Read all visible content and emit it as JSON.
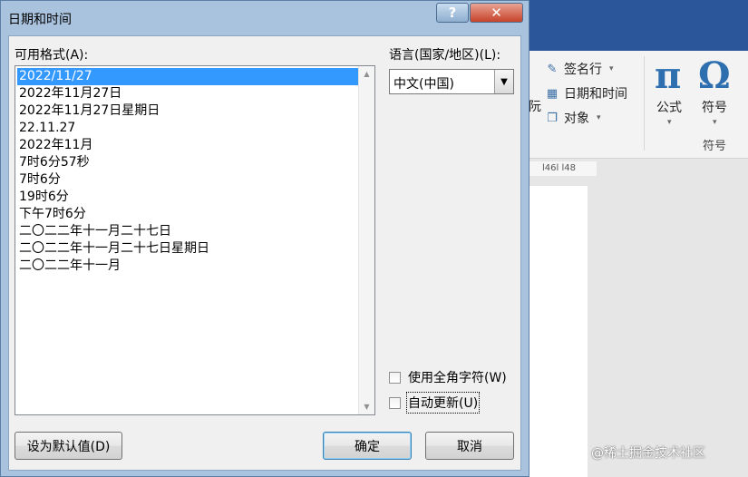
{
  "dialog": {
    "title": "日期和时间",
    "available_formats_label": "可用格式(A):",
    "formats": [
      "2022/11/27",
      "2022年11月27日",
      "2022年11月27日星期日",
      "22.11.27",
      "2022年11月",
      "7时6分57秒",
      "7时6分",
      "19时6分",
      "下午7时6分",
      "二〇二二年十一月二十七日",
      "二〇二二年十一月二十七日星期日",
      "二〇二二年十一月"
    ],
    "selected_index": 0,
    "language_label": "语言(国家/地区)(L):",
    "language_value": "中文(中国)",
    "fullwidth_label": "使用全角字符(W)",
    "auto_update_label": "自动更新(U)",
    "set_default_label": "设为默认值(D)",
    "ok_label": "确定",
    "cancel_label": "取消",
    "help_glyph": "?",
    "close_glyph": "✕"
  },
  "background": {
    "ribbon": {
      "signature_line": "签名行",
      "date_time": "日期和时间",
      "object": "对象",
      "partial_left": "阮",
      "equation_symbol": "π",
      "equation_label": "公式",
      "symbol_symbol": "Ω",
      "symbol_label": "符号",
      "group_label": "符号"
    },
    "ruler_text": "l46l  l48"
  },
  "watermark": "@稀土掘金技术社区",
  "colors": {
    "selection": "#3399ff",
    "ribbon_blue": "#2b579a",
    "symbol_blue": "#2e6fb0",
    "close_red": "#c7432b"
  }
}
